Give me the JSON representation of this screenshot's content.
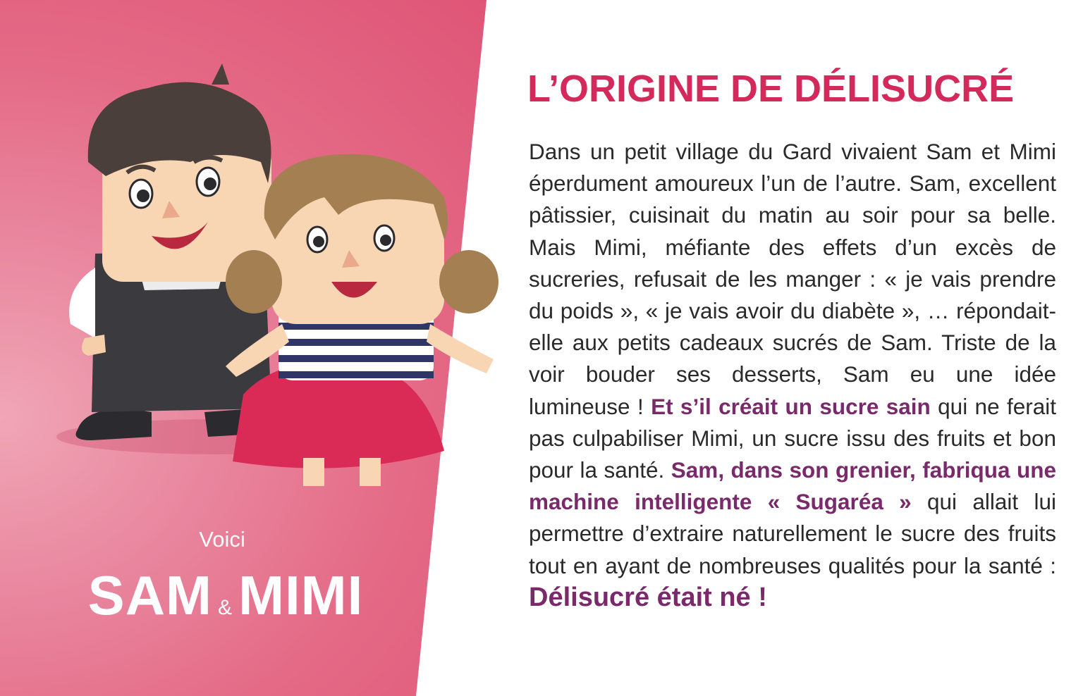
{
  "caption": {
    "voici": "Voici",
    "name1": "SAM",
    "amp": "&",
    "name2": "MIMI"
  },
  "title": "L’ORIGINE DE DÉLISUCRÉ",
  "story": {
    "p1": "Dans un petit village du Gard vivaient Sam et Mimi éperdument amoureux l’un de l’autre. Sam, excellent pâtissier, cuisinait du matin au soir pour sa belle. Mais Mimi, méfiante des effets d’un excès de sucreries, refusait de les manger : « je vais prendre du poids », « je vais avoir du diabète », … répondait-elle aux petits cadeaux sucrés de Sam. Triste de la voir bouder ses desserts, Sam eu une idée lumineuse ! ",
    "h1": "Et s’il créait un sucre sain",
    "p2": " qui ne ferait pas culpabiliser Mimi, un sucre issu des fruits et bon pour la santé. ",
    "h2": "Sam, dans son grenier, fabriqua une machine intelligente « Sugaréa »",
    "p3": " qui allait lui permettre d’extraire naturellement le sucre des fruits tout en ayant de nombreuses qualités pour la santé : ",
    "h3": "Délisucré était né !"
  },
  "colors": {
    "accent": "#d42a5b",
    "highlight": "#7a2a6a",
    "panel": "#e46a86"
  },
  "icons": {
    "characters": "sam-and-mimi-illustration"
  }
}
